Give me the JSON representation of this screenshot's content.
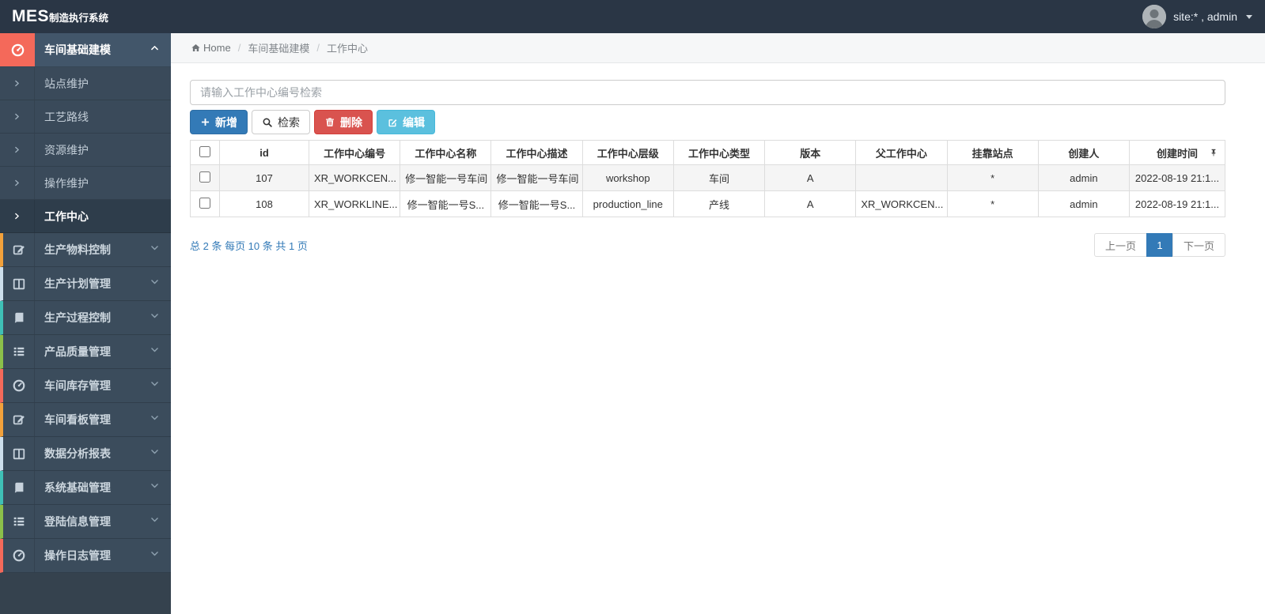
{
  "colors": {
    "topbar_bg": "#2a3645",
    "sidebar_bg": "#3b4c5c",
    "accent_red": "#f4695a",
    "primary_blue": "#337ab7",
    "danger_red": "#d9534f",
    "info_blue": "#5bc0de",
    "link_blue": "#337ab7"
  },
  "topbar": {
    "logo_mes": "MES",
    "logo_suffix": "制造执行系统",
    "user": "site:* , admin"
  },
  "breadcrumb": {
    "home": "Home",
    "sep": "/",
    "items": [
      "车间基础建模",
      "工作中心"
    ]
  },
  "sidebar": {
    "parent": {
      "label": "车间基础建模",
      "icon": "dashboard-icon",
      "state": "expanded",
      "accent": "#f4695a"
    },
    "submenu": [
      {
        "label": "站点维护",
        "active": false
      },
      {
        "label": "工艺路线",
        "active": false
      },
      {
        "label": "资源维护",
        "active": false
      },
      {
        "label": "操作维护",
        "active": false
      },
      {
        "label": "工作中心",
        "active": true
      }
    ],
    "items": [
      {
        "label": "生产物料控制",
        "icon": "pencil-icon",
        "strip": "#f2a13b"
      },
      {
        "label": "生产计划管理",
        "icon": "columns-icon",
        "strip": "#cddfec"
      },
      {
        "label": "生产过程控制",
        "icon": "book-icon",
        "strip": "#3fc0b6"
      },
      {
        "label": "产品质量管理",
        "icon": "list-icon",
        "strip": "#8bc04a"
      },
      {
        "label": "车间库存管理",
        "icon": "dashboard-icon",
        "strip": "#f4695a"
      },
      {
        "label": "车间看板管理",
        "icon": "pencil-icon",
        "strip": "#f2a13b"
      },
      {
        "label": "数据分析报表",
        "icon": "columns-icon",
        "strip": "#cddfec"
      },
      {
        "label": "系统基础管理",
        "icon": "book-icon",
        "strip": "#3fc0b6"
      },
      {
        "label": "登陆信息管理",
        "icon": "list-icon",
        "strip": "#8bc04a"
      },
      {
        "label": "操作日志管理",
        "icon": "dashboard-icon",
        "strip": "#f4695a"
      }
    ]
  },
  "search": {
    "placeholder": "请输入工作中心编号检索",
    "value": ""
  },
  "toolbar": {
    "add_label": "新增",
    "search_label": "检索",
    "delete_label": "删除",
    "edit_label": "编辑"
  },
  "table": {
    "columns": [
      "id",
      "工作中心编号",
      "工作中心名称",
      "工作中心描述",
      "工作中心层级",
      "工作中心类型",
      "版本",
      "父工作中心",
      "挂靠站点",
      "创建人",
      "创建时间"
    ],
    "rows": [
      {
        "cells": [
          "107",
          "XR_WORKCEN...",
          "修一智能一号车间",
          "修一智能一号车间",
          "workshop",
          "车间",
          "A",
          "",
          "*",
          "admin",
          "2022-08-19 21:1..."
        ]
      },
      {
        "cells": [
          "108",
          "XR_WORKLINE...",
          "修一智能一号S...",
          "修一智能一号S...",
          "production_line",
          "产线",
          "A",
          "XR_WORKCEN...",
          "*",
          "admin",
          "2022-08-19 21:1..."
        ]
      }
    ]
  },
  "pagination": {
    "summary": "总 2 条 每页 10 条 共 1 页",
    "prev": "上一页",
    "page": "1",
    "next": "下一页"
  }
}
